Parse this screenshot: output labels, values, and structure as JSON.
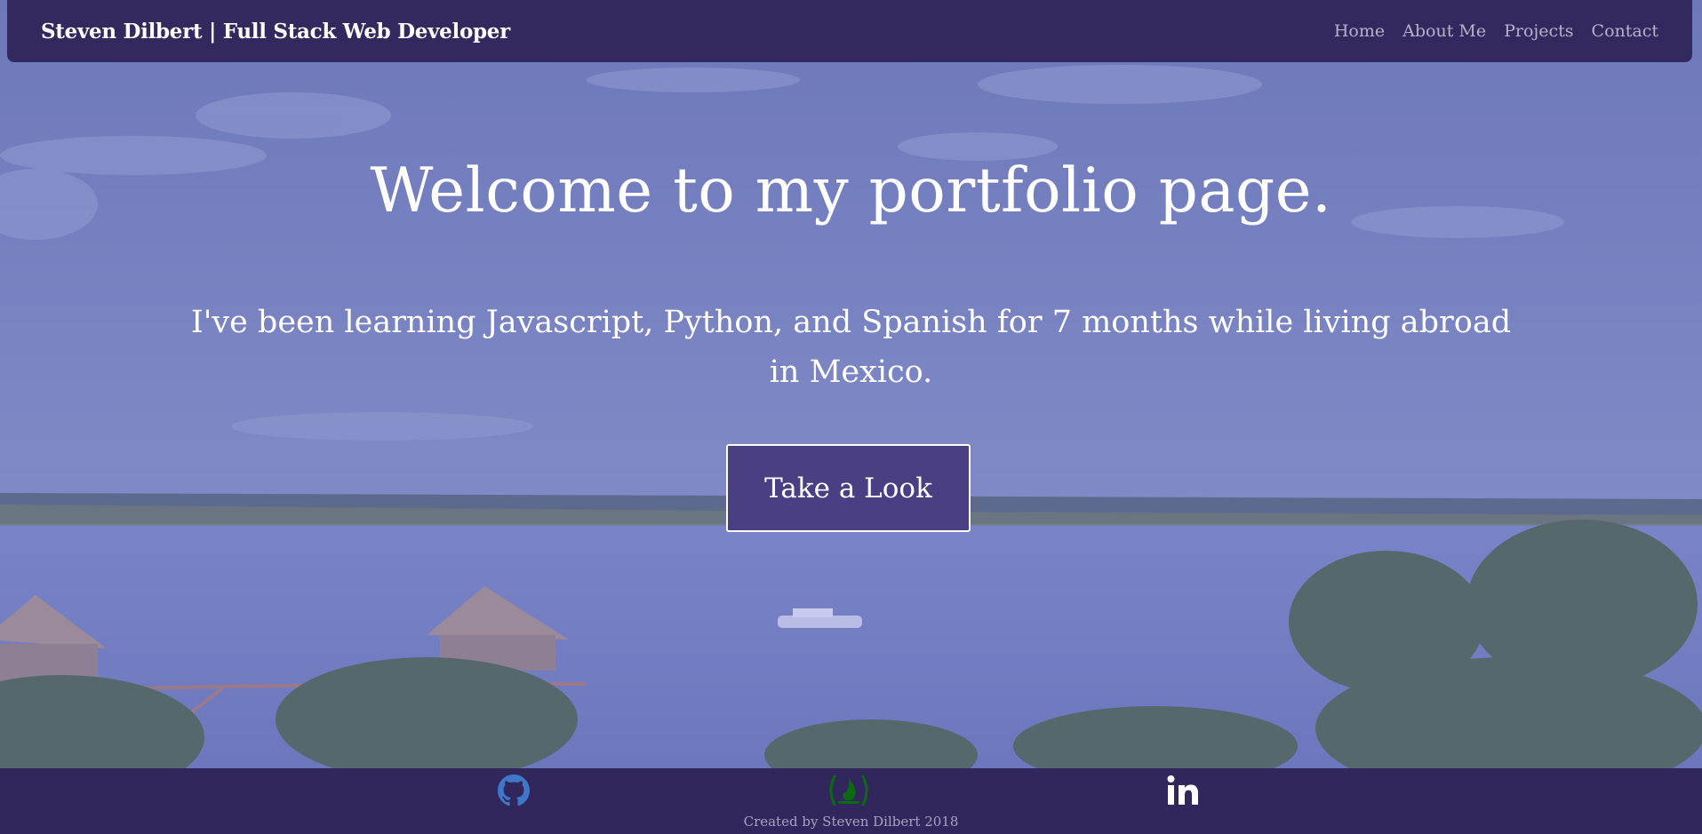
{
  "navbar": {
    "brand": "Steven Dilbert | Full Stack Web Developer",
    "links": [
      "Home",
      "About Me",
      "Projects",
      "Contact"
    ]
  },
  "hero": {
    "title": "Welcome to my portfolio page.",
    "subtitle": "I've been learning Javascript, Python, and Spanish for 7 months while living abroad in Mexico.",
    "button_label": "Take a Look",
    "background": "tropical lagoon with palm trees, palapa huts and a small boat under a blue-purple overlay"
  },
  "footer": {
    "social_icons": [
      "github-icon",
      "freecodecamp-icon",
      "linkedin-icon"
    ],
    "copyright": "Created by Steven Dilbert 2018"
  },
  "colors": {
    "navbar_bg": "#34295f",
    "footer_bg": "#31275d",
    "overlay": "#7782bf",
    "button_bg": "#4b3f83",
    "github_icon": "#3f78c8",
    "freecodecamp_icon": "#0a6b12",
    "linkedin_icon": "#ffffff"
  }
}
